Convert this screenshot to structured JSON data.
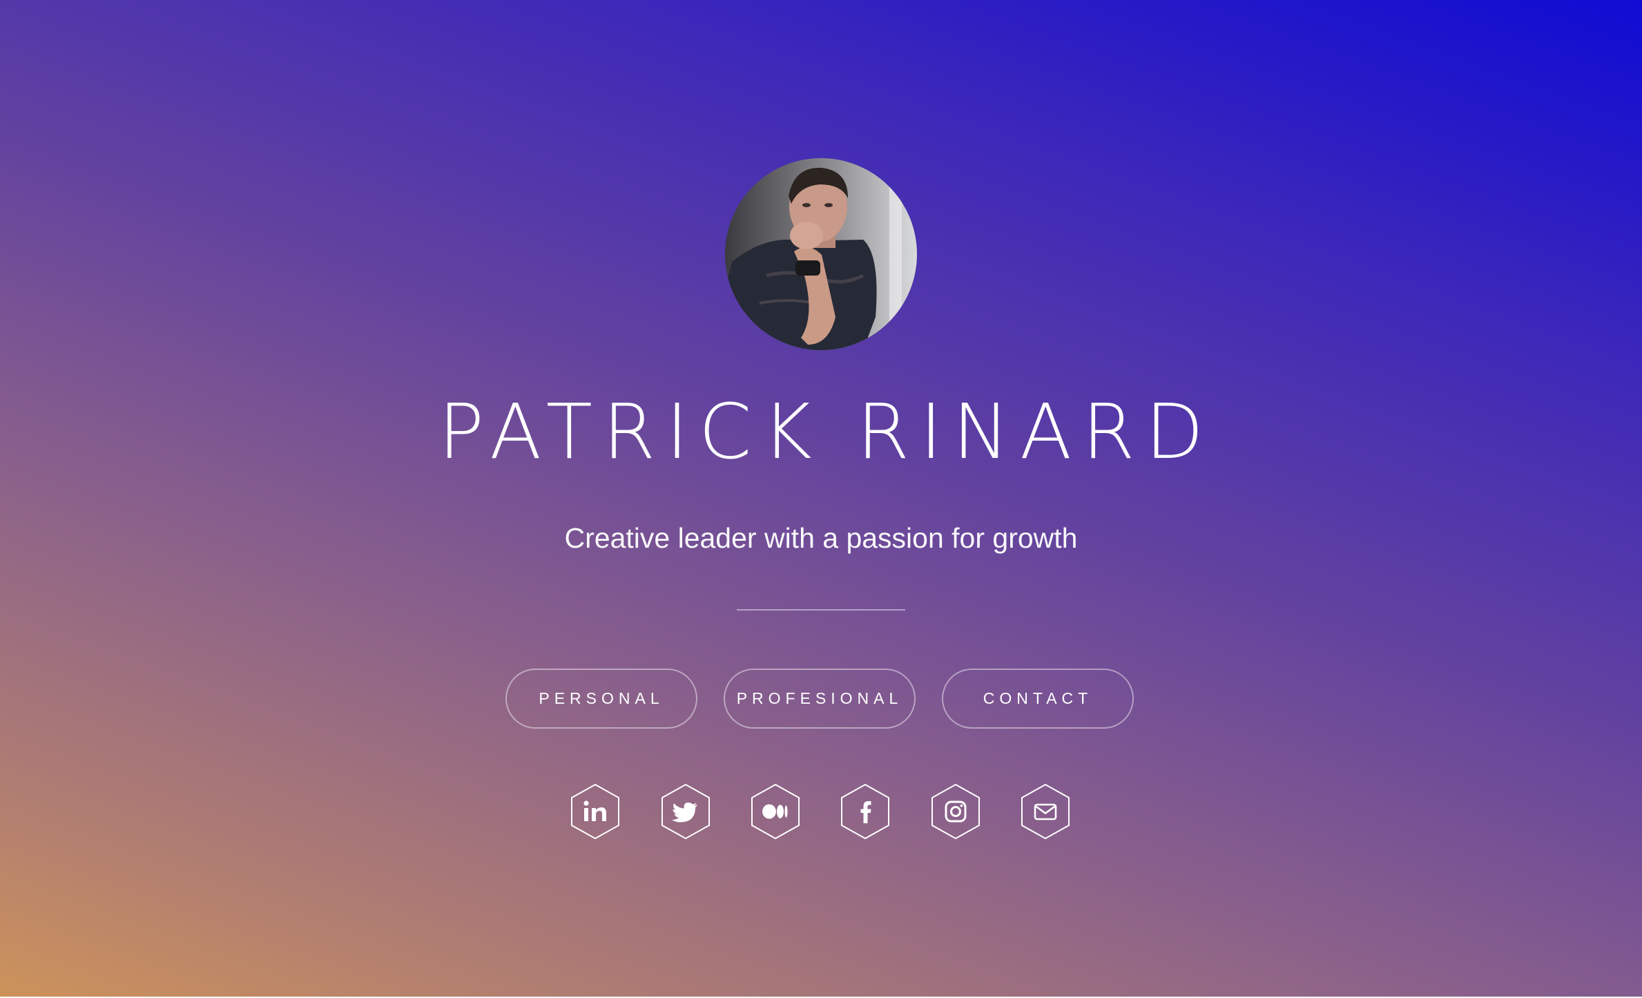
{
  "profile": {
    "name": "PATRICK RINARD",
    "tagline": "Creative leader with a passion for growth",
    "avatar_icon": "profile-photo"
  },
  "nav": {
    "buttons": [
      {
        "label": "PERSONAL"
      },
      {
        "label": "PROFESIONAL"
      },
      {
        "label": "CONTACT"
      }
    ]
  },
  "socials": [
    {
      "icon": "linkedin-icon"
    },
    {
      "icon": "twitter-icon"
    },
    {
      "icon": "medium-icon"
    },
    {
      "icon": "facebook-icon"
    },
    {
      "icon": "instagram-icon"
    },
    {
      "icon": "email-icon"
    }
  ],
  "colors": {
    "gradient_top_right": "#0f0bd3",
    "gradient_mid": "#6141a0",
    "gradient_bottom_left": "#cd935a",
    "text": "#ffffff"
  }
}
